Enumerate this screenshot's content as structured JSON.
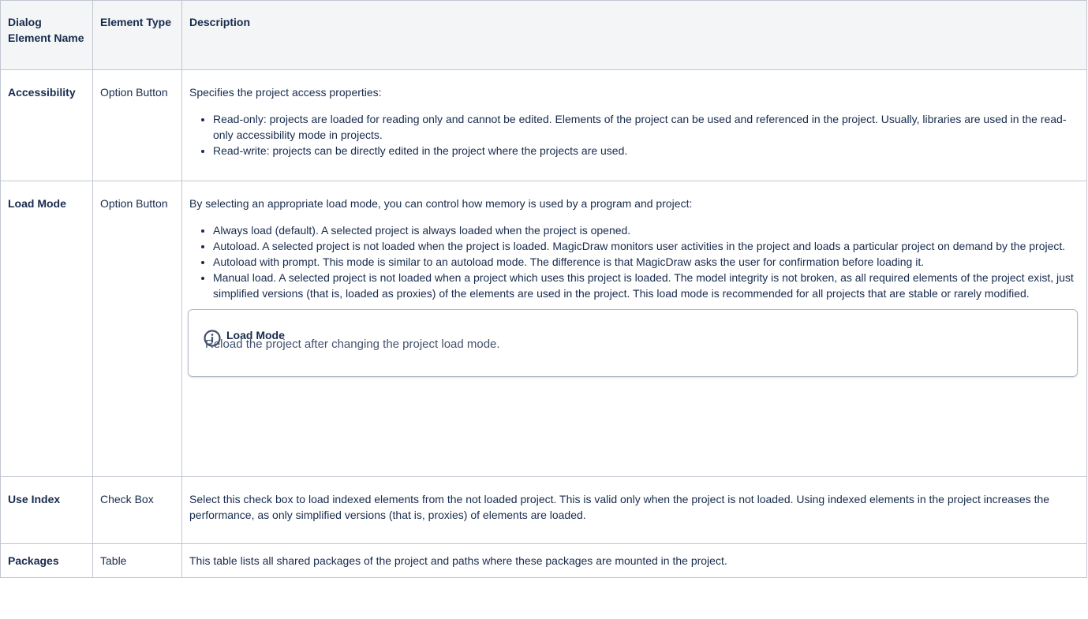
{
  "headers": {
    "name": "Dialog Element Name",
    "type": "Element Type",
    "description": "Description"
  },
  "rows": [
    {
      "name": "Accessibility",
      "type": "Option Button",
      "intro": "Specifies the project access properties:",
      "bullets": [
        "Read-only: projects are loaded for reading only and cannot be edited. Elements of the project can be used and referenced in the project. Usually, libraries are used in the read-only accessibility mode in projects.",
        "Read-write: projects can be directly edited in the project where the projects are used."
      ]
    },
    {
      "name": "Load Mode",
      "type": "Option Button",
      "intro": "By selecting an appropriate load mode, you can control how memory is used by a program and project:",
      "bullets": [
        "Always load (default). A selected project is always loaded when the project is opened.",
        "Autoload. A selected project is not loaded when the project is loaded. MagicDraw monitors user activities in the project and loads a particular project on demand by the project.",
        "Autoload with prompt. This mode is similar to an autoload mode. The difference is that MagicDraw asks the user for confirmation before loading it.",
        "Manual load. A selected project is not loaded when a project which uses this project is loaded. The model integrity is not broken, as all required elements of the project exist, just simplified versions (that is, loaded as proxies) of the elements are used in the project. This load mode is recommended for all projects that are stable or rarely modified."
      ],
      "note": {
        "title": "Load Mode",
        "body": "Reload the project after changing the project load mode.",
        "icon": "info-icon",
        "icon_color": "#42526e"
      }
    },
    {
      "name": "Use Index",
      "type": "Check Box",
      "intro": "Select this check box to load indexed elements from the not loaded project. This is valid only when the project is not loaded. Using indexed elements in the project increases the performance, as only simplified versions (that is, proxies) of elements are loaded."
    },
    {
      "name": "Packages",
      "type": "Table",
      "intro": "This table lists all shared packages of the project and paths where these packages are mounted in the project."
    }
  ]
}
